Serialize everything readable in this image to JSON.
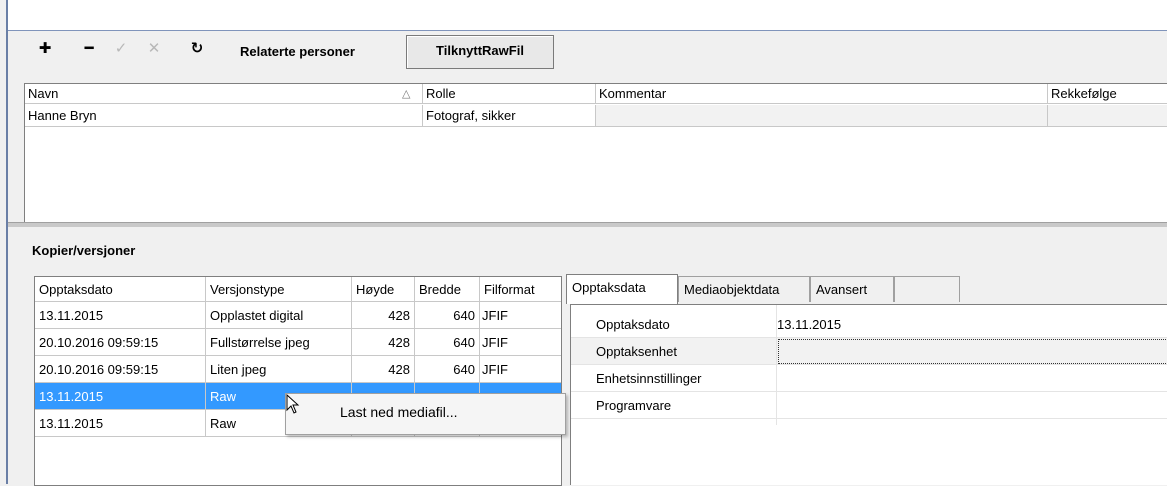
{
  "toolbar": {
    "add_icon": "plus-icon",
    "remove_icon": "minus-icon",
    "edit_icon": "pencil-icon",
    "cancel_icon": "x-icon",
    "refresh_icon": "refresh-icon",
    "related_label": "Relaterte personer",
    "raw_button": "TilknyttRawFil"
  },
  "persons": {
    "columns": [
      "Navn",
      "Rolle",
      "Kommentar",
      "Rekkefølge"
    ],
    "rows": [
      {
        "navn": "Hanne Bryn",
        "rolle": "Fotograf, sikker",
        "kommentar": "",
        "rekkefolge": ""
      }
    ]
  },
  "versions": {
    "title": "Kopier/versjoner",
    "columns": [
      "Opptaksdato",
      "Versjonstype",
      "Høyde",
      "Bredde",
      "Filformat"
    ],
    "rows": [
      {
        "dato": "13.11.2015",
        "type": "Opplastet digital",
        "hoyde": "428",
        "bredde": "640",
        "format": "JFIF"
      },
      {
        "dato": "20.10.2016 09:59:15",
        "type": "Fullstørrelse jpeg",
        "hoyde": "428",
        "bredde": "640",
        "format": "JFIF"
      },
      {
        "dato": "20.10.2016 09:59:15",
        "type": "Liten jpeg",
        "hoyde": "428",
        "bredde": "640",
        "format": "JFIF"
      },
      {
        "dato": "13.11.2015",
        "type": "Raw",
        "hoyde": "",
        "bredde": "",
        "format": ""
      },
      {
        "dato": "13.11.2015",
        "type": "Raw",
        "hoyde": "",
        "bredde": "",
        "format": ""
      }
    ]
  },
  "context_menu": {
    "item": "Last ned mediafil..."
  },
  "tabs": [
    "Opptaksdata",
    "Mediaobjektdata",
    "Avansert",
    ""
  ],
  "details": {
    "rows": [
      {
        "label": "Opptaksdato",
        "value": "13.11.2015"
      },
      {
        "label": "Opptaksenhet",
        "value": ""
      },
      {
        "label": "Enhetsinnstillinger",
        "value": ""
      },
      {
        "label": "Programvare",
        "value": ""
      }
    ]
  },
  "colors": {
    "selection": "#3399ff",
    "frame": "#6a7fa6"
  }
}
